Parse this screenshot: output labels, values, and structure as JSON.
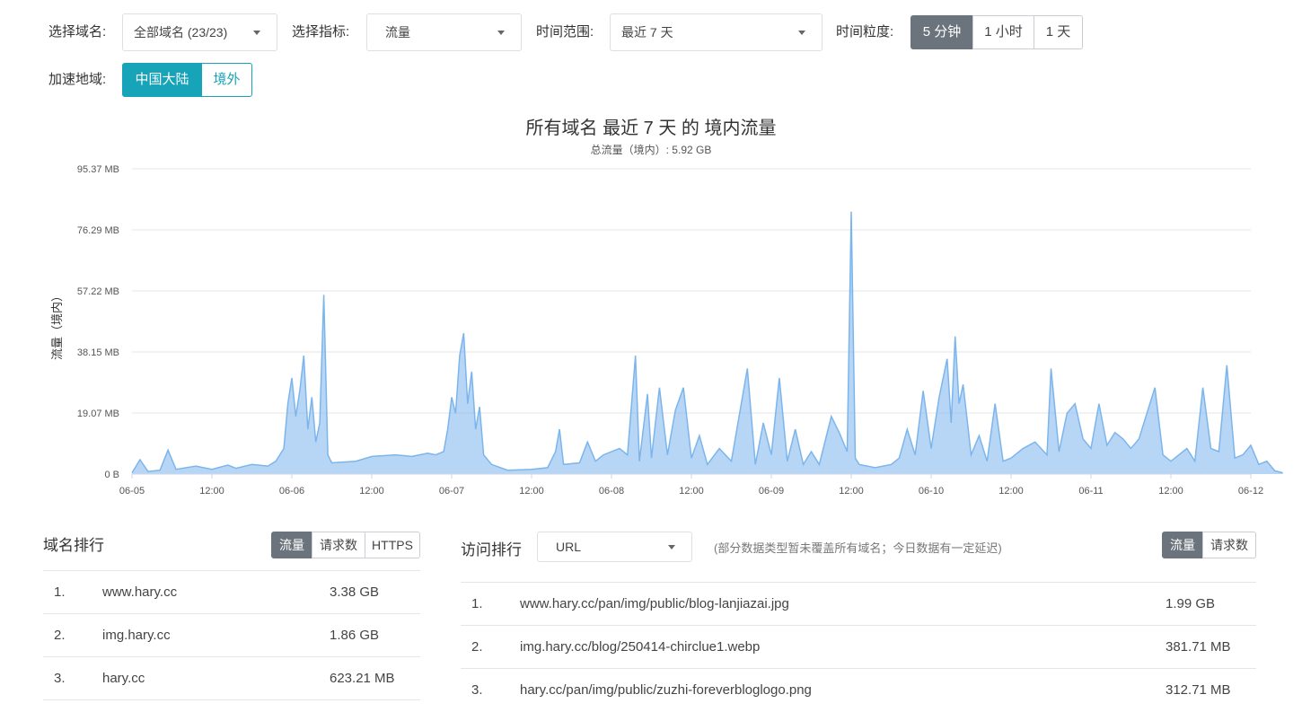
{
  "filters": {
    "domain_label": "选择域名:",
    "domain_value": "全部域名 (23/23)",
    "metric_label": "选择指标:",
    "metric_value": "流量",
    "range_label": "时间范围:",
    "range_value": "最近 7 天",
    "granularity_label": "时间粒度:",
    "granularity_options": [
      "5 分钟",
      "1 小时",
      "1 天"
    ],
    "region_label": "加速地域:",
    "region_options": [
      "中国大陆",
      "境外"
    ]
  },
  "chart_data": {
    "type": "area",
    "title": "所有域名 最近 7 天 的 境内流量",
    "subtitle": "总流量（境内）: 5.92 GB",
    "ylabel": "流量（境内）",
    "yticks": [
      "0 B",
      "19.07 MB",
      "38.15 MB",
      "57.22 MB",
      "76.29 MB",
      "95.37 MB"
    ],
    "ylim_mb": [
      0,
      95.37
    ],
    "xticks": [
      "06-05",
      "12:00",
      "06-06",
      "12:00",
      "06-07",
      "12:00",
      "06-08",
      "12:00",
      "06-09",
      "12:00",
      "06-10",
      "12:00",
      "06-11",
      "12:00",
      "06-12"
    ],
    "color": "#7cb5ec",
    "grid": true,
    "series": [
      {
        "points": [
          [
            0.0,
            0.4
          ],
          [
            0.1,
            4.5
          ],
          [
            0.2,
            0.8
          ],
          [
            0.35,
            1.2
          ],
          [
            0.45,
            7.5
          ],
          [
            0.55,
            1.5
          ],
          [
            0.8,
            2.5
          ],
          [
            1.0,
            1.5
          ],
          [
            1.2,
            2.8
          ],
          [
            1.3,
            1.8
          ],
          [
            1.5,
            3.0
          ],
          [
            1.7,
            2.5
          ],
          [
            1.8,
            4.0
          ],
          [
            1.9,
            8.0
          ],
          [
            1.95,
            22
          ],
          [
            2.0,
            30
          ],
          [
            2.05,
            18
          ],
          [
            2.1,
            26
          ],
          [
            2.15,
            37
          ],
          [
            2.2,
            14
          ],
          [
            2.25,
            24
          ],
          [
            2.3,
            10
          ],
          [
            2.35,
            16
          ],
          [
            2.4,
            56
          ],
          [
            2.45,
            6
          ],
          [
            2.5,
            3.5
          ],
          [
            2.8,
            4.0
          ],
          [
            3.0,
            5.5
          ],
          [
            3.3,
            6.0
          ],
          [
            3.5,
            5.5
          ],
          [
            3.7,
            6.5
          ],
          [
            3.8,
            6.0
          ],
          [
            3.9,
            7.0
          ],
          [
            3.95,
            14
          ],
          [
            4.0,
            24
          ],
          [
            4.05,
            19
          ],
          [
            4.1,
            37
          ],
          [
            4.15,
            44
          ],
          [
            4.2,
            22
          ],
          [
            4.25,
            32
          ],
          [
            4.3,
            14
          ],
          [
            4.35,
            21
          ],
          [
            4.4,
            6
          ],
          [
            4.5,
            3.0
          ],
          [
            4.7,
            1.2
          ],
          [
            5.0,
            1.5
          ],
          [
            5.2,
            2.0
          ],
          [
            5.3,
            7.0
          ],
          [
            5.35,
            14
          ],
          [
            5.4,
            3.0
          ],
          [
            5.6,
            3.5
          ],
          [
            5.7,
            10
          ],
          [
            5.8,
            4.0
          ],
          [
            5.9,
            6.0
          ],
          [
            6.1,
            8.0
          ],
          [
            6.2,
            6.0
          ],
          [
            6.3,
            37
          ],
          [
            6.35,
            4.0
          ],
          [
            6.45,
            25
          ],
          [
            6.5,
            5.0
          ],
          [
            6.6,
            27
          ],
          [
            6.7,
            6.0
          ],
          [
            6.8,
            20
          ],
          [
            6.9,
            27
          ],
          [
            7.0,
            5.0
          ],
          [
            7.1,
            12
          ],
          [
            7.2,
            3.0
          ],
          [
            7.35,
            8.0
          ],
          [
            7.5,
            4.0
          ],
          [
            7.7,
            33
          ],
          [
            7.8,
            3.0
          ],
          [
            7.9,
            16
          ],
          [
            8.0,
            6.0
          ],
          [
            8.1,
            30
          ],
          [
            8.2,
            4.0
          ],
          [
            8.3,
            14
          ],
          [
            8.4,
            3.0
          ],
          [
            8.5,
            7.0
          ],
          [
            8.6,
            3.0
          ],
          [
            8.75,
            18
          ],
          [
            8.85,
            13
          ],
          [
            8.95,
            7.0
          ],
          [
            9.0,
            82
          ],
          [
            9.05,
            5.0
          ],
          [
            9.1,
            3.0
          ],
          [
            9.3,
            2.0
          ],
          [
            9.5,
            3.0
          ],
          [
            9.6,
            5.0
          ],
          [
            9.7,
            14
          ],
          [
            9.8,
            6.0
          ],
          [
            9.9,
            26
          ],
          [
            10.0,
            8.0
          ],
          [
            10.1,
            24
          ],
          [
            10.2,
            36
          ],
          [
            10.25,
            16
          ],
          [
            10.3,
            43
          ],
          [
            10.35,
            22
          ],
          [
            10.4,
            28
          ],
          [
            10.5,
            6.0
          ],
          [
            10.6,
            12
          ],
          [
            10.7,
            4.0
          ],
          [
            10.8,
            22
          ],
          [
            10.9,
            4.0
          ],
          [
            11.0,
            5.0
          ],
          [
            11.15,
            8.0
          ],
          [
            11.3,
            10
          ],
          [
            11.45,
            6.0
          ],
          [
            11.5,
            33
          ],
          [
            11.6,
            7.0
          ],
          [
            11.7,
            19
          ],
          [
            11.8,
            22
          ],
          [
            11.9,
            11
          ],
          [
            12.0,
            8.0
          ],
          [
            12.1,
            22
          ],
          [
            12.2,
            9.0
          ],
          [
            12.3,
            13
          ],
          [
            12.4,
            11
          ],
          [
            12.5,
            8.0
          ],
          [
            12.6,
            11
          ],
          [
            12.8,
            27
          ],
          [
            12.9,
            6.0
          ],
          [
            13.0,
            4.0
          ],
          [
            13.2,
            8.0
          ],
          [
            13.3,
            4.0
          ],
          [
            13.4,
            27
          ],
          [
            13.5,
            8.0
          ],
          [
            13.6,
            7.0
          ],
          [
            13.7,
            34
          ],
          [
            13.8,
            5.0
          ],
          [
            13.9,
            6.0
          ],
          [
            14.0,
            9.0
          ],
          [
            14.1,
            3.0
          ],
          [
            14.2,
            4.0
          ],
          [
            14.3,
            1.0
          ],
          [
            14.4,
            0.4
          ]
        ]
      }
    ]
  },
  "domain_rank": {
    "title": "域名排行",
    "tabs": [
      "流量",
      "请求数",
      "HTTPS"
    ],
    "rows": [
      {
        "rank": "1.",
        "name": "www.hary.cc",
        "value": "3.38 GB"
      },
      {
        "rank": "2.",
        "name": "img.hary.cc",
        "value": "1.86 GB"
      },
      {
        "rank": "3.",
        "name": "hary.cc",
        "value": "623.21 MB"
      }
    ]
  },
  "visit_rank": {
    "title": "访问排行",
    "select_value": "URL",
    "note": "(部分数据类型暂未覆盖所有域名；今日数据有一定延迟)",
    "tabs": [
      "流量",
      "请求数"
    ],
    "rows": [
      {
        "rank": "1.",
        "url": "www.hary.cc/pan/img/public/blog-lanjiazai.jpg",
        "value": "1.99 GB"
      },
      {
        "rank": "2.",
        "url": "img.hary.cc/blog/250414-chirclue1.webp",
        "value": "381.71 MB"
      },
      {
        "rank": "3.",
        "url": "hary.cc/pan/img/public/zuzhi-foreverbloglogo.png",
        "value": "312.71 MB"
      }
    ]
  }
}
